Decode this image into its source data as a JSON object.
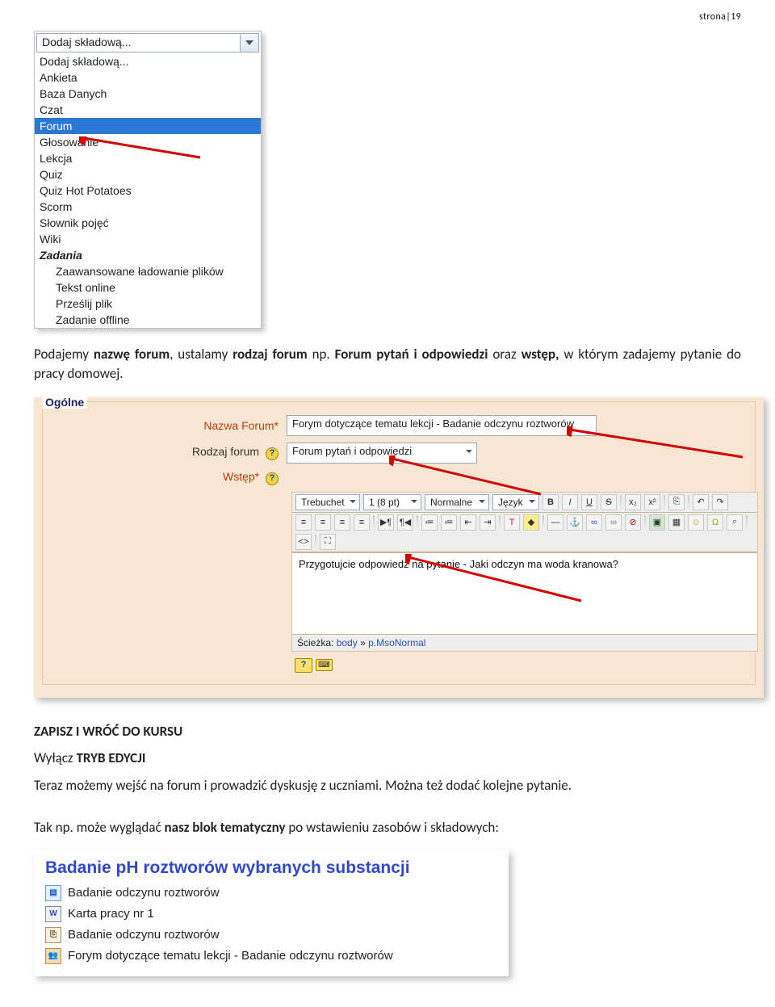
{
  "page_number": "strona|19",
  "dropdown": {
    "selected": "Dodaj składową...",
    "items": [
      {
        "label": "Dodaj składową...",
        "kind": "plain"
      },
      {
        "label": "Ankieta",
        "kind": "plain"
      },
      {
        "label": "Baza Danych",
        "kind": "plain"
      },
      {
        "label": "Czat",
        "kind": "plain"
      },
      {
        "label": "Forum",
        "kind": "hi"
      },
      {
        "label": "Głosowanie",
        "kind": "plain"
      },
      {
        "label": "Lekcja",
        "kind": "plain"
      },
      {
        "label": "Quiz",
        "kind": "plain"
      },
      {
        "label": "Quiz Hot Potatoes",
        "kind": "plain"
      },
      {
        "label": "Scorm",
        "kind": "plain"
      },
      {
        "label": "Słownik pojęć",
        "kind": "plain"
      },
      {
        "label": "Wiki",
        "kind": "plain"
      },
      {
        "label": "Zadania",
        "kind": "cat"
      },
      {
        "label": "Zaawansowane ładowanie plików",
        "kind": "sub"
      },
      {
        "label": "Tekst online",
        "kind": "sub"
      },
      {
        "label": "Prześlij plik",
        "kind": "sub"
      },
      {
        "label": "Zadanie offline",
        "kind": "sub"
      }
    ]
  },
  "para1": {
    "t1": "Podajemy ",
    "t2": "nazwę forum",
    "t3": ", ustalamy ",
    "t4": "rodzaj forum",
    "t5": " np. ",
    "t6": "Forum pytań i odpowiedzi",
    "t7": " oraz ",
    "t8": "wstęp,",
    "t9": " w którym zadajemy pytanie do pracy domowej."
  },
  "form": {
    "legend": "Ogólne",
    "labels": {
      "name": "Nazwa Forum*",
      "type": "Rodzaj forum",
      "intro": "Wstęp*"
    },
    "name_value": "Forym dotyczące tematu lekcji - Badanie odczynu roztworów",
    "type_value": "Forum pytań i odpowiedzi",
    "toolbar": {
      "font": "Trebuchet",
      "size": "1 (8 pt)",
      "style": "Normalne",
      "lang": "Język"
    },
    "editor_text": "Przygotujcie odpowiedź na pytanie - Jaki odczyn ma woda kranowa?",
    "path_label": "Ścieżka:",
    "path_links": [
      "body",
      "p.MsoNormal"
    ]
  },
  "para2": {
    "l1": "ZAPISZ I WRÓĆ DO KURSU",
    "l2a": "Wyłącz ",
    "l2b": "TRYB EDYCJI",
    "l3": "Teraz możemy wejść na forum i prowadzić dyskusję z uczniami. Można też dodać kolejne pytanie.",
    "l4a": "Tak np. może wyglądać ",
    "l4b": "nasz blok tematyczny",
    "l4c": " po wstawieniu zasobów i składowych:"
  },
  "block": {
    "title": "Badanie pH roztworów wybranych substancji",
    "items": [
      {
        "icon": "web",
        "label": "Badanie odczynu roztworów"
      },
      {
        "icon": "doc",
        "label": "Karta pracy nr 1"
      },
      {
        "icon": "link",
        "label": "Badanie odczynu roztworów"
      },
      {
        "icon": "forum",
        "label": "Forym dotyczące tematu lekcji - Badanie odczynu roztworów"
      }
    ]
  }
}
